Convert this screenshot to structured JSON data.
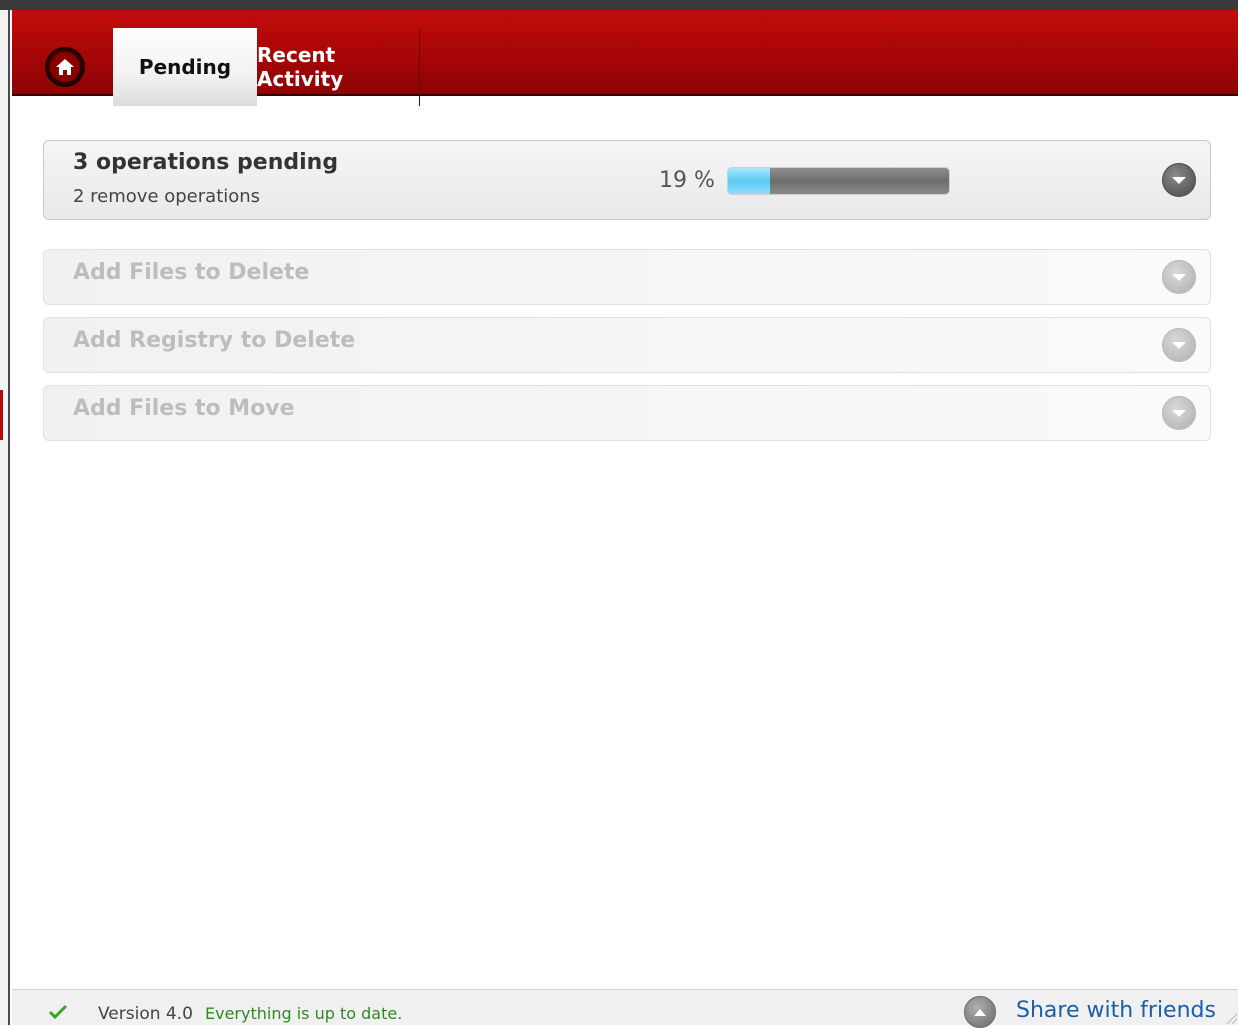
{
  "header": {
    "home_icon": "home-icon",
    "tabs": [
      {
        "label": "Pending",
        "active": true
      },
      {
        "label": "Recent Activity",
        "active": false
      }
    ]
  },
  "operations": {
    "title": "3  operations pending",
    "subtitle": "2 remove operations",
    "progress_label": "19 %",
    "progress_value": 0.19
  },
  "actions": [
    {
      "label": "Add Files to Delete"
    },
    {
      "label": "Add Registry to Delete"
    },
    {
      "label": "Add Files to Move"
    }
  ],
  "footer": {
    "version_label": "Version  4.0",
    "status_text": "Everything is up to date.",
    "share_label": "Share with friends"
  },
  "colors": {
    "brand_red": "#a60606",
    "progress_blue": "#5bcaf4",
    "status_green": "#2e8a1e",
    "link_blue": "#1a5fa8"
  }
}
